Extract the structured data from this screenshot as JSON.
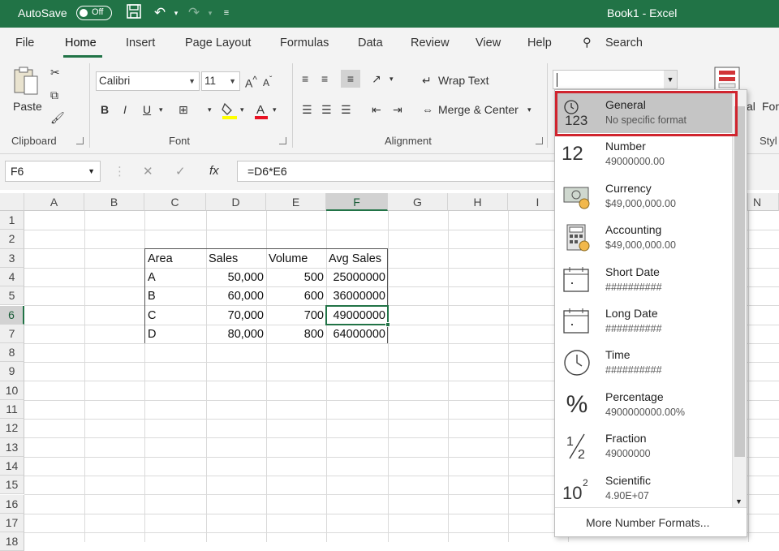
{
  "titlebar": {
    "autosave": "AutoSave",
    "autosave_state": "Off",
    "title": "Book1  -  Excel"
  },
  "tabs": [
    "File",
    "Home",
    "Insert",
    "Page Layout",
    "Formulas",
    "Data",
    "Review",
    "View",
    "Help"
  ],
  "search": "Search",
  "ribbon": {
    "clipboard": {
      "paste": "Paste",
      "label": "Clipboard"
    },
    "font": {
      "name": "Calibri",
      "size": "11",
      "bold": "B",
      "italic": "I",
      "underline": "U",
      "grow": "A",
      "shrink": "A",
      "label": "Font"
    },
    "alignment": {
      "wrap": "Wrap Text",
      "merge": "Merge & Center",
      "label": "Alignment"
    },
    "partial": {
      "al": "al",
      "for": "For",
      "sty": "Styl"
    }
  },
  "formula_bar": {
    "name_box": "F6",
    "fx": "fx",
    "formula": "=D6*E6"
  },
  "grid": {
    "columns": [
      "A",
      "B",
      "C",
      "D",
      "E",
      "F",
      "G",
      "H",
      "I",
      "N"
    ],
    "rows": [
      "1",
      "2",
      "3",
      "4",
      "5",
      "6",
      "7",
      "8",
      "9",
      "10",
      "11",
      "12",
      "13",
      "14",
      "15",
      "16",
      "17",
      "18"
    ],
    "active_cell": "F6",
    "headers": [
      "Area",
      "Sales",
      "Volume",
      "Avg Sales"
    ],
    "data": [
      [
        "A",
        "50,000",
        "500",
        "25000000"
      ],
      [
        "B",
        "60,000",
        "600",
        "36000000"
      ],
      [
        "C",
        "70,000",
        "700",
        "49000000"
      ],
      [
        "D",
        "80,000",
        "800",
        "64000000"
      ]
    ]
  },
  "number_format_menu": {
    "items": [
      {
        "name": "General",
        "sample": "No specific format",
        "icon": "clock-123-icon"
      },
      {
        "name": "Number",
        "sample": "49000000.00",
        "icon": "number-12-icon"
      },
      {
        "name": "Currency",
        "sample": "$49,000,000.00",
        "icon": "currency-icon"
      },
      {
        "name": "Accounting",
        "sample": "$49,000,000.00",
        "icon": "calculator-icon"
      },
      {
        "name": "Short Date",
        "sample": "##########",
        "icon": "calendar-icon"
      },
      {
        "name": "Long Date",
        "sample": "##########",
        "icon": "calendar-icon"
      },
      {
        "name": "Time",
        "sample": "##########",
        "icon": "clock-icon"
      },
      {
        "name": "Percentage",
        "sample": "4900000000.00%",
        "icon": "percent-icon"
      },
      {
        "name": "Fraction",
        "sample": "49000000",
        "icon": "fraction-icon"
      },
      {
        "name": "Scientific",
        "sample": "4.90E+07",
        "icon": "scientific-icon"
      }
    ],
    "more": "More Number Formats..."
  },
  "colors": {
    "excel_green": "#217346",
    "highlight_red": "#d0242e",
    "selected_item": "#c5c5c5"
  }
}
